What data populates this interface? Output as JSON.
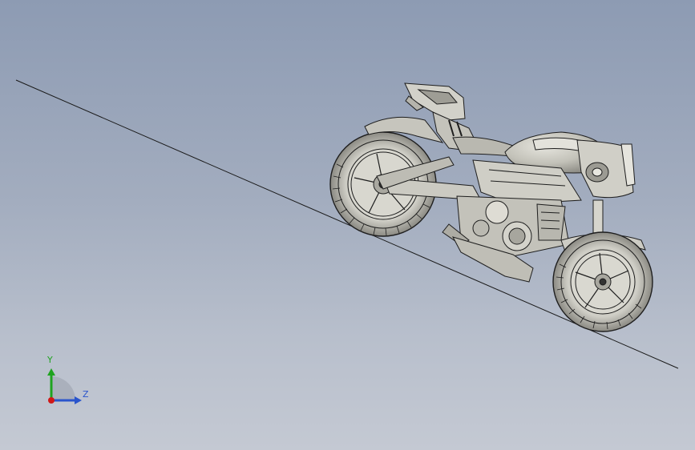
{
  "scene": {
    "background_top": "#8d9bb3",
    "background_bottom": "#c4c9d3",
    "model_color": "#c9c8c0",
    "edge_color": "#1a1a1a"
  },
  "triad": {
    "y_label": "Y",
    "z_label": "Z",
    "y_color": "#1fa31f",
    "z_color": "#2a55cc",
    "x_color": "#d01818"
  }
}
